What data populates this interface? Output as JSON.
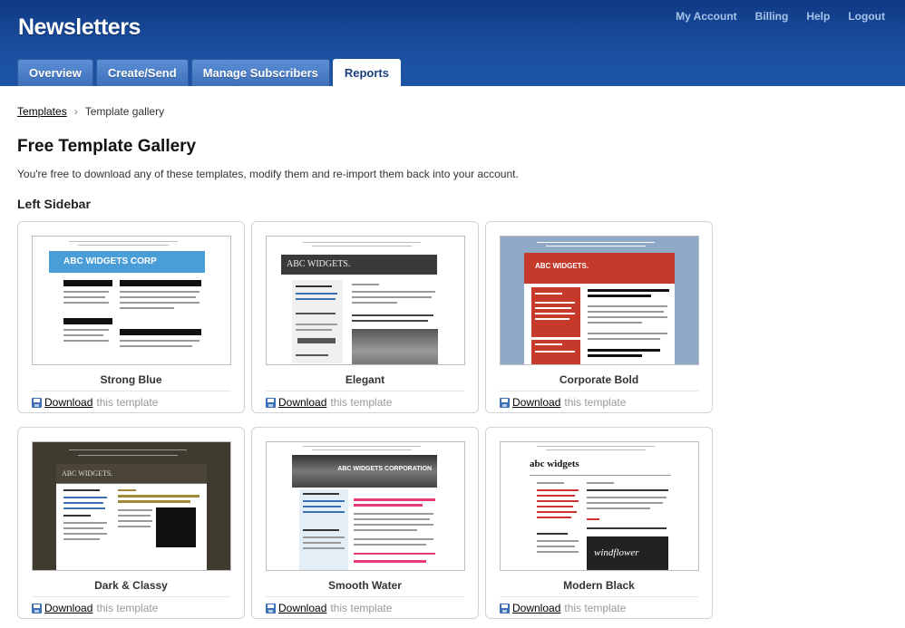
{
  "header": {
    "title": "Newsletters",
    "top_links": [
      "My Account",
      "Billing",
      "Help",
      "Logout"
    ],
    "tabs": [
      {
        "label": "Overview",
        "active": false
      },
      {
        "label": "Create/Send",
        "active": false
      },
      {
        "label": "Manage Subscribers",
        "active": false
      },
      {
        "label": "Reports",
        "active": true
      }
    ]
  },
  "breadcrumb": {
    "parent": "Templates",
    "separator": "›",
    "current": "Template gallery"
  },
  "page": {
    "title": "Free Template Gallery",
    "description": "You're free to download any of these templates, modify them and re-import them back into your account.",
    "section": "Left Sidebar"
  },
  "download": {
    "link_label": "Download",
    "suffix": "this template"
  },
  "templates": [
    {
      "name": "Strong Blue",
      "thumb_title": "ABC WIDGETS CORP"
    },
    {
      "name": "Elegant",
      "thumb_title": "ABC WIDGETS."
    },
    {
      "name": "Corporate Bold",
      "thumb_title": "ABC WIDGETS."
    },
    {
      "name": "Dark & Classy",
      "thumb_title": "ABC WIDGETS."
    },
    {
      "name": "Smooth Water",
      "thumb_title": "ABC WIDGETS CORPORATION"
    },
    {
      "name": "Modern Black",
      "thumb_title": "abc widgets",
      "thumb_photo_text": "windflower"
    }
  ],
  "colors": {
    "header": "#1b4f9f",
    "tab": "#4a7cc6",
    "strong_blue": "#4a9ed8",
    "corporate_red": "#c53a2b",
    "smooth_pink": "#e8397d"
  }
}
